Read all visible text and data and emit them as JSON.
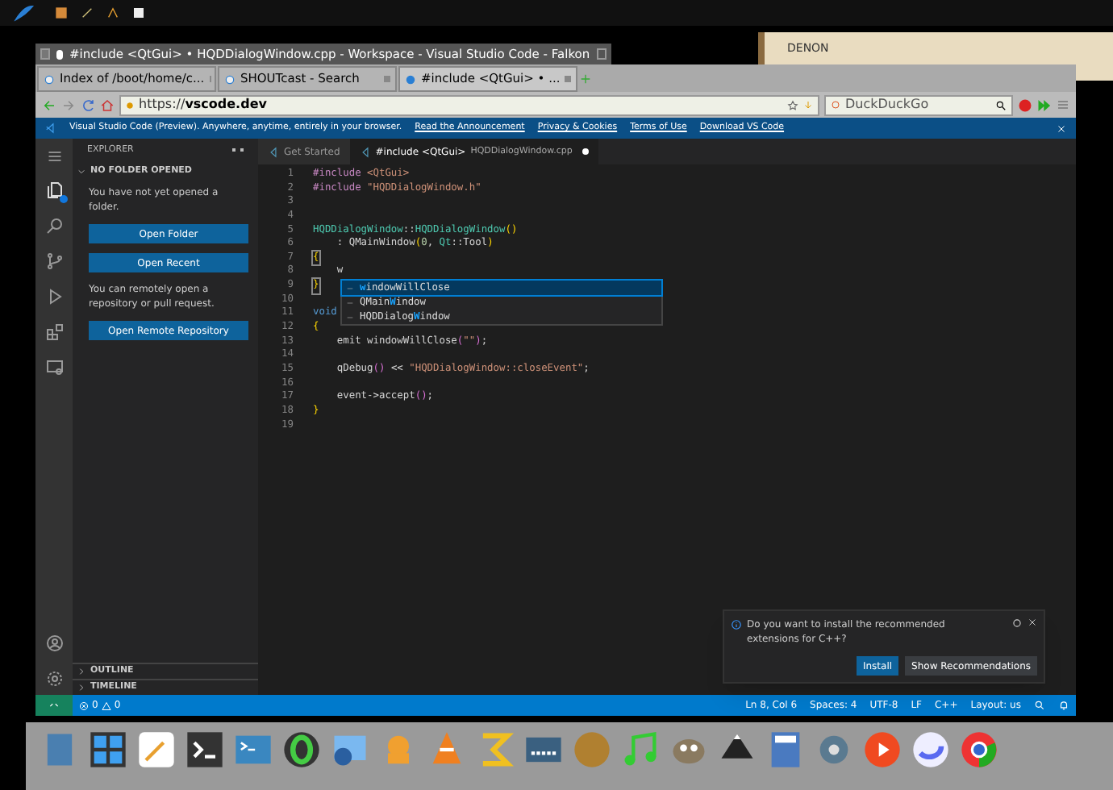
{
  "backdrop": {
    "label": "DENON"
  },
  "browser": {
    "title": "#include <QtGui> • HQDDialogWindow.cpp - Workspace - Visual Studio Code - Falkon",
    "tabs": [
      {
        "label": "Index of /boot/home/c...",
        "selected": false
      },
      {
        "label": "SHOUTcast - Search",
        "selected": false
      },
      {
        "label": "#include <QtGui> • ...",
        "selected": true
      }
    ],
    "address": {
      "scheme": "https://",
      "host": "vscode.dev"
    },
    "search": {
      "placeholder": "DuckDuckGo"
    }
  },
  "banner": {
    "text": "Visual Studio Code (Preview). Anywhere, anytime, entirely in your browser.",
    "links": [
      "Read the Announcement",
      "Privacy & Cookies",
      "Terms of Use",
      "Download VS Code"
    ]
  },
  "explorer": {
    "title": "EXPLORER",
    "section": "NO FOLDER OPENED",
    "expanded": true,
    "items": [
      {
        "kind": "text",
        "label": "You have not yet opened a folder."
      },
      {
        "kind": "button",
        "label": "Open Folder"
      },
      {
        "kind": "button",
        "label": "Open Recent"
      },
      {
        "kind": "text",
        "label": "You can remotely open a repository or pull request."
      },
      {
        "kind": "button",
        "label": "Open Remote Repository"
      }
    ],
    "panels": [
      {
        "label": "OUTLINE",
        "expanded": false
      },
      {
        "label": "TIMELINE",
        "expanded": false
      }
    ]
  },
  "editor": {
    "tabs": [
      {
        "title": "Get Started",
        "selected": false,
        "modified": false
      },
      {
        "title": "#include <QtGui>",
        "description": "HQDDialogWindow.cpp",
        "selected": true,
        "modified": true
      }
    ],
    "lines": [
      {
        "number": "1",
        "tokens": [
          {
            "kind": "keyword",
            "text": "#include "
          },
          {
            "kind": "string",
            "text": "<QtGui>"
          }
        ]
      },
      {
        "number": "2",
        "tokens": [
          {
            "kind": "keyword",
            "text": "#include "
          },
          {
            "kind": "string",
            "text": "\"HQDDialogWindow.h\""
          }
        ]
      },
      {
        "number": "3"
      },
      {
        "number": "4"
      },
      {
        "number": "5",
        "tokens": [
          {
            "kind": "type",
            "text": "HQDDialogWindow"
          },
          {
            "kind": "plain",
            "text": "::"
          },
          {
            "kind": "type",
            "text": "HQDDialogWindow"
          },
          {
            "kind": "bracket",
            "text": "()"
          }
        ]
      },
      {
        "number": "6",
        "tokens": [
          {
            "kind": "plain",
            "text": "    : QMainWindow"
          },
          {
            "kind": "bracket",
            "text": "("
          },
          {
            "kind": "number",
            "text": "0"
          },
          {
            "kind": "plain",
            "text": ", "
          },
          {
            "kind": "type",
            "text": "Qt"
          },
          {
            "kind": "plain",
            "text": "::Tool"
          },
          {
            "kind": "bracket",
            "text": ")"
          }
        ]
      },
      {
        "number": "7",
        "tokens": [
          {
            "kind": "bracket-match",
            "text": "{"
          }
        ]
      },
      {
        "number": "8",
        "tokens": [
          {
            "kind": "plain",
            "text": "    w"
          }
        ]
      },
      {
        "number": "9",
        "tokens": [
          {
            "kind": "bracket-match",
            "text": "}"
          }
        ]
      },
      {
        "number": "10"
      },
      {
        "number": "11",
        "tokens": [
          {
            "kind": "keyword-blue",
            "text": "void"
          }
        ]
      },
      {
        "number": "12",
        "tokens": [
          {
            "kind": "bracket",
            "text": "{"
          }
        ]
      },
      {
        "number": "13",
        "tokens": [
          {
            "kind": "plain",
            "text": "    emit windowWillClose"
          },
          {
            "kind": "bracket-2",
            "text": "("
          },
          {
            "kind": "string",
            "text": "\"\""
          },
          {
            "kind": "bracket-2",
            "text": ")"
          },
          {
            "kind": "plain",
            "text": ";"
          }
        ]
      },
      {
        "number": "14"
      },
      {
        "number": "15",
        "tokens": [
          {
            "kind": "plain",
            "text": "    qDebug"
          },
          {
            "kind": "bracket-2",
            "text": "()"
          },
          {
            "kind": "plain",
            "text": " << "
          },
          {
            "kind": "string",
            "text": "\"HQDDialogWindow::closeEvent\""
          },
          {
            "kind": "plain",
            "text": ";"
          }
        ]
      },
      {
        "number": "16"
      },
      {
        "number": "17",
        "tokens": [
          {
            "kind": "plain",
            "text": "    event->accept"
          },
          {
            "kind": "bracket-2",
            "text": "()"
          },
          {
            "kind": "plain",
            "text": ";"
          }
        ]
      },
      {
        "number": "18",
        "tokens": [
          {
            "kind": "bracket",
            "text": "}"
          }
        ]
      },
      {
        "number": "19"
      }
    ],
    "suggestions": [
      {
        "match": "w",
        "after": "indowWillClose",
        "selected": true
      },
      {
        "before": "QMain",
        "match": "W",
        "after": "indow",
        "selected": false
      },
      {
        "before": "HQDDialog",
        "match": "W",
        "after": "indow",
        "selected": false
      }
    ]
  },
  "notification": {
    "message": "Do you want to install the recommended extensions for C++?",
    "buttons": [
      {
        "label": "Install",
        "kind": "primary"
      },
      {
        "label": "Show Recommendations",
        "kind": "secondary"
      }
    ]
  },
  "status_bar": {
    "errors": "0",
    "warnings": "0",
    "items": [
      "Ln 8, Col 6",
      "Spaces: 4",
      "UTF-8",
      "LF",
      "C++",
      "Layout: us"
    ]
  }
}
